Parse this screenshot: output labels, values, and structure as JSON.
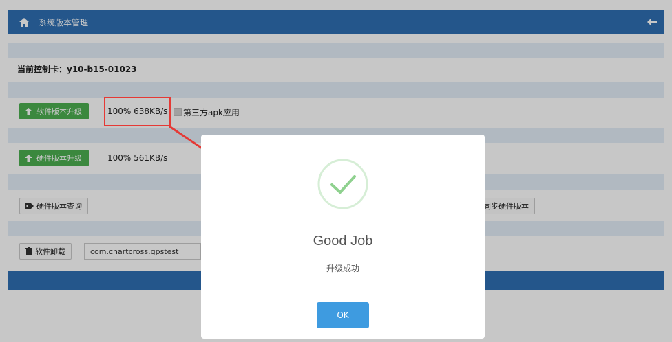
{
  "header": {
    "title": "系统版本管理",
    "icon_home": "home-icon",
    "icon_back": "arrow-left-icon"
  },
  "control_card": {
    "label": "当前控制卡：y10-b15-01023"
  },
  "software_upgrade": {
    "button_label": "软件版本升级",
    "speed_text": "100% 638KB/s",
    "third_party_label": "第三方apk应用"
  },
  "hardware_upgrade": {
    "button_label": "硬件版本升级",
    "speed_text": "100% 561KB/s"
  },
  "query": {
    "query_button_label": "硬件版本查询",
    "sync_button_label": "同步硬件版本"
  },
  "uninstall": {
    "button_label": "软件卸载",
    "package_value": "com.chartcross.gpstest"
  },
  "modal": {
    "title": "Good Job",
    "message": "升级成功",
    "ok_label": "OK"
  },
  "colors": {
    "header_blue": "#2f6fb2",
    "green": "#4caf50",
    "ok_blue": "#3e9be0",
    "success_green": "#8fd18f",
    "highlight_red": "#e53935"
  }
}
